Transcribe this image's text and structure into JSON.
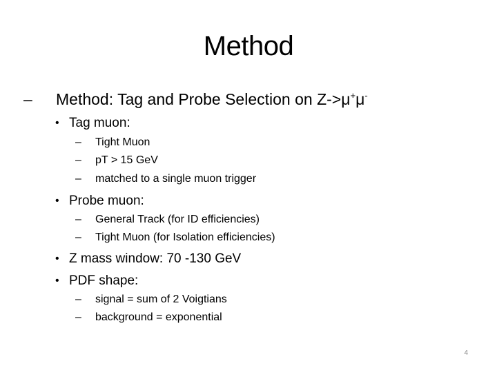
{
  "slide": {
    "title": "Method",
    "page_number": "4",
    "heading": {
      "marker": "–",
      "text": "Method: Tag and Probe Selection on Z->μ",
      "sup1": "+",
      "mid": "μ",
      "sup2": "-"
    },
    "bullets": [
      {
        "marker": "•",
        "text": "Tag muon:",
        "subitems": [
          {
            "marker": "–",
            "text": "Tight Muon"
          },
          {
            "marker": "–",
            "text": "pT > 15 GeV"
          },
          {
            "marker": "–",
            "text": "matched to a single muon trigger"
          }
        ]
      },
      {
        "marker": "•",
        "text": "Probe muon:",
        "subitems": [
          {
            "marker": "–",
            "text": "General Track (for ID efficiencies)"
          },
          {
            "marker": "–",
            "text": "Tight Muon (for Isolation efficiencies)"
          }
        ]
      },
      {
        "marker": "•",
        "text": "Z mass window: 70 -130 GeV",
        "subitems": []
      },
      {
        "marker": "•",
        "text": "PDF shape:",
        "subitems": [
          {
            "marker": "–",
            "text": "signal = sum of 2 Voigtians"
          },
          {
            "marker": "–",
            "text": "background = exponential"
          }
        ]
      }
    ]
  }
}
